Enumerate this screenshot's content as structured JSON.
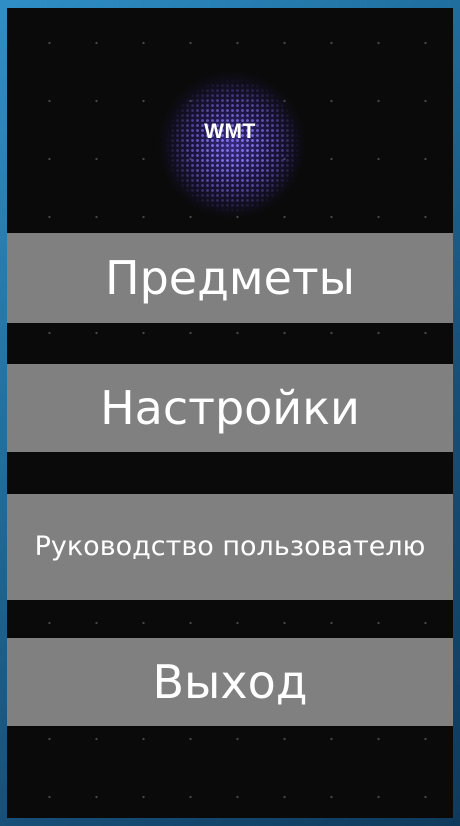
{
  "logo": {
    "text": "WMT"
  },
  "menu": {
    "items_label": "Предметы",
    "settings_label": "Настройки",
    "guide_label": "Руководство пользователю",
    "exit_label": "Выход"
  },
  "colors": {
    "screen_background": "#0a0a0a",
    "button_background": "#808080",
    "button_text": "#ffffff",
    "logo_glow": "#5a46e6",
    "outer_background": "#1f6f9f"
  }
}
